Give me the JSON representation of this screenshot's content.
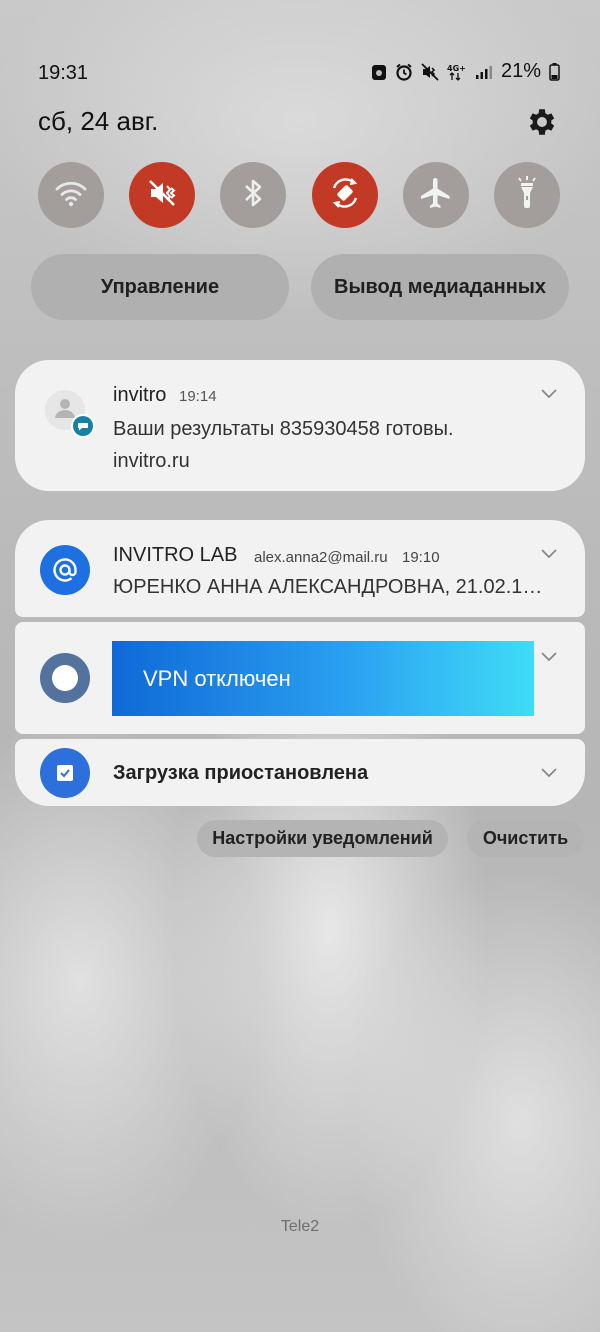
{
  "status_bar": {
    "time": "19:31",
    "network": "4G+",
    "battery": "21%",
    "icons": [
      "screenshot-icon",
      "alarm-icon",
      "mute-icon",
      "network-4g-icon",
      "signal-icon",
      "battery-icon"
    ]
  },
  "date": "сб, 24 авг.",
  "quick_settings": [
    {
      "name": "wifi",
      "active": false
    },
    {
      "name": "mute",
      "active": true
    },
    {
      "name": "bluetooth",
      "active": false
    },
    {
      "name": "auto-rotate",
      "active": true
    },
    {
      "name": "airplane-mode",
      "active": false
    },
    {
      "name": "flashlight",
      "active": false
    }
  ],
  "panel_buttons": {
    "control": "Управление",
    "media_output": "Вывод медиаданных"
  },
  "notifications": {
    "invitro": {
      "app": "invitro",
      "time": "19:14",
      "text": "Ваши результаты 835930458 готовы.",
      "sub": "invitro.ru"
    },
    "mail": {
      "app": "INVITRO LAB",
      "account": "alex.anna2@mail.ru",
      "time": "19:10",
      "text": "ЮРЕНКО АННА АЛЕКСАНДРОВНА, 21.02.19…"
    },
    "vpn": {
      "text": "VPN отключен"
    },
    "download": {
      "text": "Загрузка приостановлена"
    }
  },
  "actions": {
    "settings": "Настройки уведомлений",
    "clear": "Очистить"
  },
  "carrier": "Tele2",
  "colors": {
    "active_tile": "#c23a26",
    "inactive_tile": "#a39d9b",
    "mail_icon": "#1e6fe0",
    "vpn_icon": "#53729e"
  }
}
